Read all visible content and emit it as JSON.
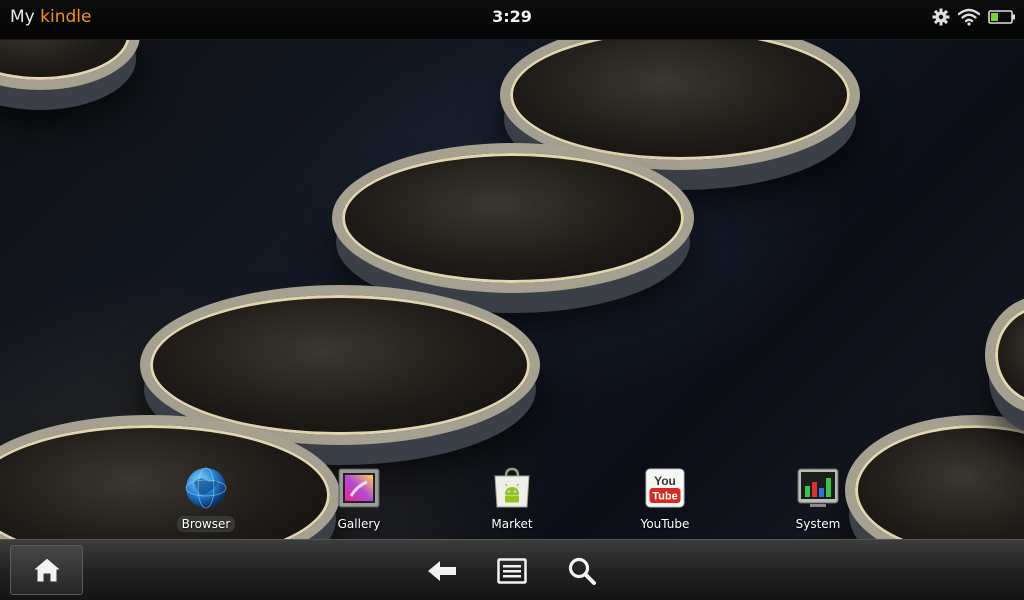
{
  "status_bar": {
    "brand_prefix": "My",
    "brand_name": "kindle",
    "time": "3:29",
    "icons": [
      "gear-icon",
      "wifi-icon",
      "battery-icon"
    ]
  },
  "colors": {
    "brand_accent": "#f09320",
    "battery_fill": "#7bd13a"
  },
  "battery": {
    "level": 0.35
  },
  "apps": [
    {
      "label": "Browser",
      "icon": "globe-icon",
      "selected": true
    },
    {
      "label": "Gallery",
      "icon": "gallery-icon",
      "selected": false
    },
    {
      "label": "Market",
      "icon": "android-market-icon",
      "selected": false
    },
    {
      "label": "YouTube",
      "icon": "youtube-icon",
      "selected": false
    },
    {
      "label": "System",
      "icon": "system-monitor-icon",
      "selected": false
    }
  ],
  "youtube_logo": {
    "top": "You",
    "bottom": "Tube"
  },
  "nav_bar": {
    "icons": [
      "home-icon",
      "back-arrow-icon",
      "menu-icon",
      "search-icon"
    ]
  }
}
